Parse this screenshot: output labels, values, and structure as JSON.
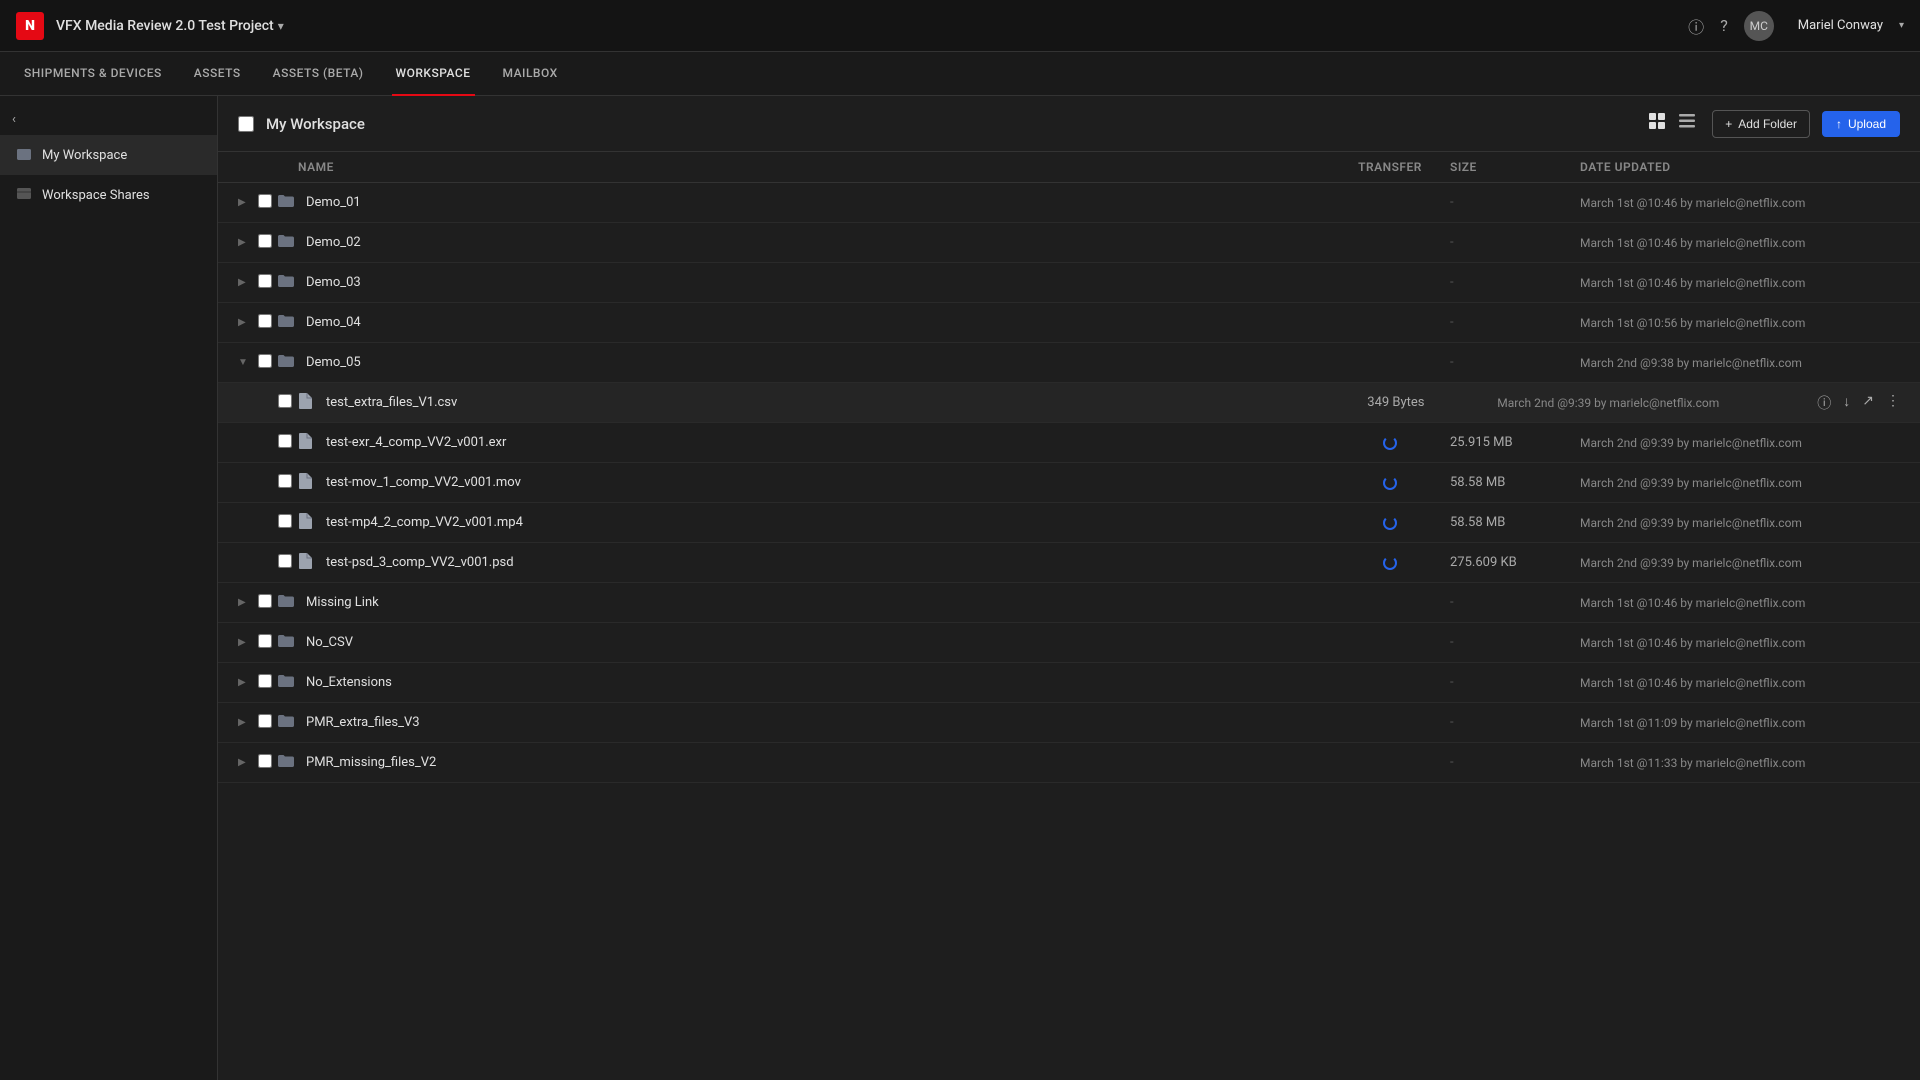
{
  "topbar": {
    "logo": "N",
    "project_title": "VFX Media Review 2.0 Test Project",
    "project_arrow": "▾",
    "user_name": "Mariel Conway",
    "info_icon": "ⓘ",
    "help_icon": "?"
  },
  "navbar": {
    "items": [
      {
        "label": "SHIPMENTS & DEVICES",
        "active": false
      },
      {
        "label": "ASSETS",
        "active": false
      },
      {
        "label": "ASSETS (BETA)",
        "active": false
      },
      {
        "label": "WORKSPACE",
        "active": true
      },
      {
        "label": "MAILBOX",
        "active": false
      }
    ]
  },
  "sidebar": {
    "collapse_icon": "‹",
    "items": [
      {
        "label": "My Workspace",
        "icon": "folder",
        "active": true
      },
      {
        "label": "Workspace Shares",
        "icon": "share",
        "active": false
      }
    ]
  },
  "content": {
    "header": {
      "title": "My Workspace",
      "add_folder_label": "Add Folder",
      "upload_label": "Upload",
      "upload_icon": "↑"
    },
    "table": {
      "columns": {
        "name": "Name",
        "transfer": "Transfer",
        "size": "Size",
        "date": "Date Updated"
      }
    },
    "rows": [
      {
        "type": "folder",
        "name": "Demo_01",
        "expanded": false,
        "indent": 0,
        "size": "-",
        "date": "March 1st @10:46 by marielc@netflix.com",
        "children": []
      },
      {
        "type": "folder",
        "name": "Demo_02",
        "expanded": false,
        "indent": 0,
        "size": "-",
        "date": "March 1st @10:46 by marielc@netflix.com",
        "children": []
      },
      {
        "type": "folder",
        "name": "Demo_03",
        "expanded": false,
        "indent": 0,
        "size": "-",
        "date": "March 1st @10:46 by marielc@netflix.com",
        "children": []
      },
      {
        "type": "folder",
        "name": "Demo_04",
        "expanded": false,
        "indent": 0,
        "size": "-",
        "date": "March 1st @10:56 by marielc@netflix.com",
        "children": []
      },
      {
        "type": "folder",
        "name": "Demo_05",
        "expanded": true,
        "indent": 0,
        "size": "-",
        "date": "March 2nd @9:38 by marielc@netflix.com",
        "children": [
          {
            "type": "file",
            "name": "test_extra_files_V1.csv",
            "indent": 1,
            "size": "349 Bytes",
            "transfer": "",
            "date": "March 2nd @9:39 by marielc@netflix.com",
            "selected": true
          },
          {
            "type": "file",
            "name": "test-exr_4_comp_VV2_v001.exr",
            "indent": 1,
            "size": "25.915 MB",
            "transfer": "spinner",
            "date": "March 2nd @9:39 by marielc@netflix.com"
          },
          {
            "type": "file",
            "name": "test-mov_1_comp_VV2_v001.mov",
            "indent": 1,
            "size": "58.58 MB",
            "transfer": "spinner",
            "date": "March 2nd @9:39 by marielc@netflix.com"
          },
          {
            "type": "file",
            "name": "test-mp4_2_comp_VV2_v001.mp4",
            "indent": 1,
            "size": "58.58 MB",
            "transfer": "spinner",
            "date": "March 2nd @9:39 by marielc@netflix.com"
          },
          {
            "type": "file",
            "name": "test-psd_3_comp_VV2_v001.psd",
            "indent": 1,
            "size": "275.609 KB",
            "transfer": "spinner",
            "date": "March 2nd @9:39 by marielc@netflix.com"
          }
        ]
      },
      {
        "type": "folder",
        "name": "Missing Link",
        "expanded": false,
        "indent": 0,
        "size": "-",
        "date": "March 1st @10:46 by marielc@netflix.com"
      },
      {
        "type": "folder",
        "name": "No_CSV",
        "expanded": false,
        "indent": 0,
        "size": "-",
        "date": "March 1st @10:46 by marielc@netflix.com"
      },
      {
        "type": "folder",
        "name": "No_Extensions",
        "expanded": false,
        "indent": 0,
        "size": "-",
        "date": "March 1st @10:46 by marielc@netflix.com"
      },
      {
        "type": "folder",
        "name": "PMR_extra_files_V3",
        "expanded": false,
        "indent": 0,
        "size": "-",
        "date": "March 1st @11:09 by marielc@netflix.com"
      },
      {
        "type": "folder",
        "name": "PMR_missing_files_V2",
        "expanded": false,
        "indent": 0,
        "size": "-",
        "date": "March 1st @11:33 by marielc@netflix.com"
      }
    ]
  }
}
